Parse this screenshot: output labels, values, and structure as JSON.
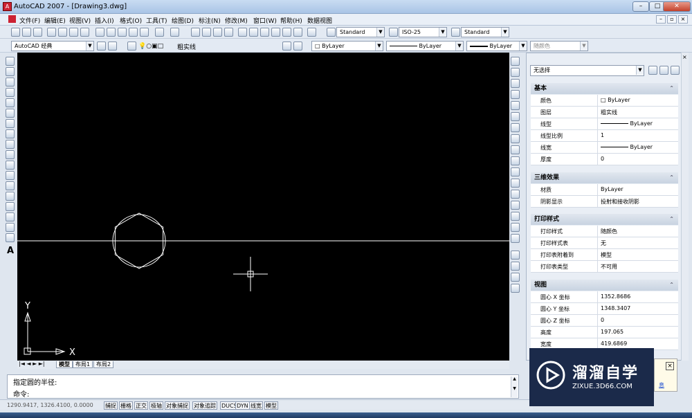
{
  "title": "AutoCAD 2007 - [Drawing3.dwg]",
  "menus": [
    "文件(F)",
    "编辑(E)",
    "视图(V)",
    "插入(I)",
    "格式(O)",
    "工具(T)",
    "绘图(D)",
    "标注(N)",
    "修改(M)",
    "窗口(W)",
    "帮助(H)",
    "数据视图"
  ],
  "styles": {
    "text_style": "Standard",
    "dim_style": "ISO-25",
    "table_style": "Standard"
  },
  "workspace": "AutoCAD 经典",
  "layer": "粗实线",
  "color": "ByLayer",
  "linetype": "ByLayer",
  "lineweight": "ByLayer",
  "plotstyle": "随颜色",
  "ucs": {
    "y": "Y",
    "x": "X"
  },
  "tabs": [
    "模型",
    "布局1",
    "布局2"
  ],
  "command": {
    "line1": "指定圆的半径:",
    "line2": "命令:"
  },
  "coords": "1290.9417, 1326.4100, 0.0000",
  "status_buttons": [
    "捕捉",
    "栅格",
    "正交",
    "极轴",
    "对象捕捉",
    "对象追踪",
    "DUCS",
    "DYN",
    "线宽",
    "模型"
  ],
  "props": {
    "selection": "无选择",
    "sections": [
      {
        "title": "基本",
        "rows": [
          {
            "k": "颜色",
            "v": "ByLayer",
            "swatch": true
          },
          {
            "k": "图层",
            "v": "粗实线"
          },
          {
            "k": "线型",
            "v": "ByLayer",
            "line": true
          },
          {
            "k": "线型比例",
            "v": "1"
          },
          {
            "k": "线宽",
            "v": "ByLayer",
            "line": true
          },
          {
            "k": "厚度",
            "v": "0"
          }
        ]
      },
      {
        "title": "三维效果",
        "rows": [
          {
            "k": "材质",
            "v": "ByLayer"
          },
          {
            "k": "阴影显示",
            "v": "投射和接收阴影"
          }
        ]
      },
      {
        "title": "打印样式",
        "rows": [
          {
            "k": "打印样式",
            "v": "随颜色"
          },
          {
            "k": "打印样式表",
            "v": "无"
          },
          {
            "k": "打印表附着到",
            "v": "模型"
          },
          {
            "k": "打印表类型",
            "v": "不可用"
          }
        ]
      },
      {
        "title": "视图",
        "rows": [
          {
            "k": "圆心 X 坐标",
            "v": "1352.8686"
          },
          {
            "k": "圆心 Y 坐标",
            "v": "1348.3407"
          },
          {
            "k": "圆心 Z 坐标",
            "v": "0"
          },
          {
            "k": "高度",
            "v": "197.065"
          },
          {
            "k": "宽度",
            "v": "419.6869"
          }
        ]
      }
    ]
  },
  "watermark": {
    "brand": "溜溜自学",
    "url": "ZIXUE.3D66.COM",
    "extra": "息"
  }
}
